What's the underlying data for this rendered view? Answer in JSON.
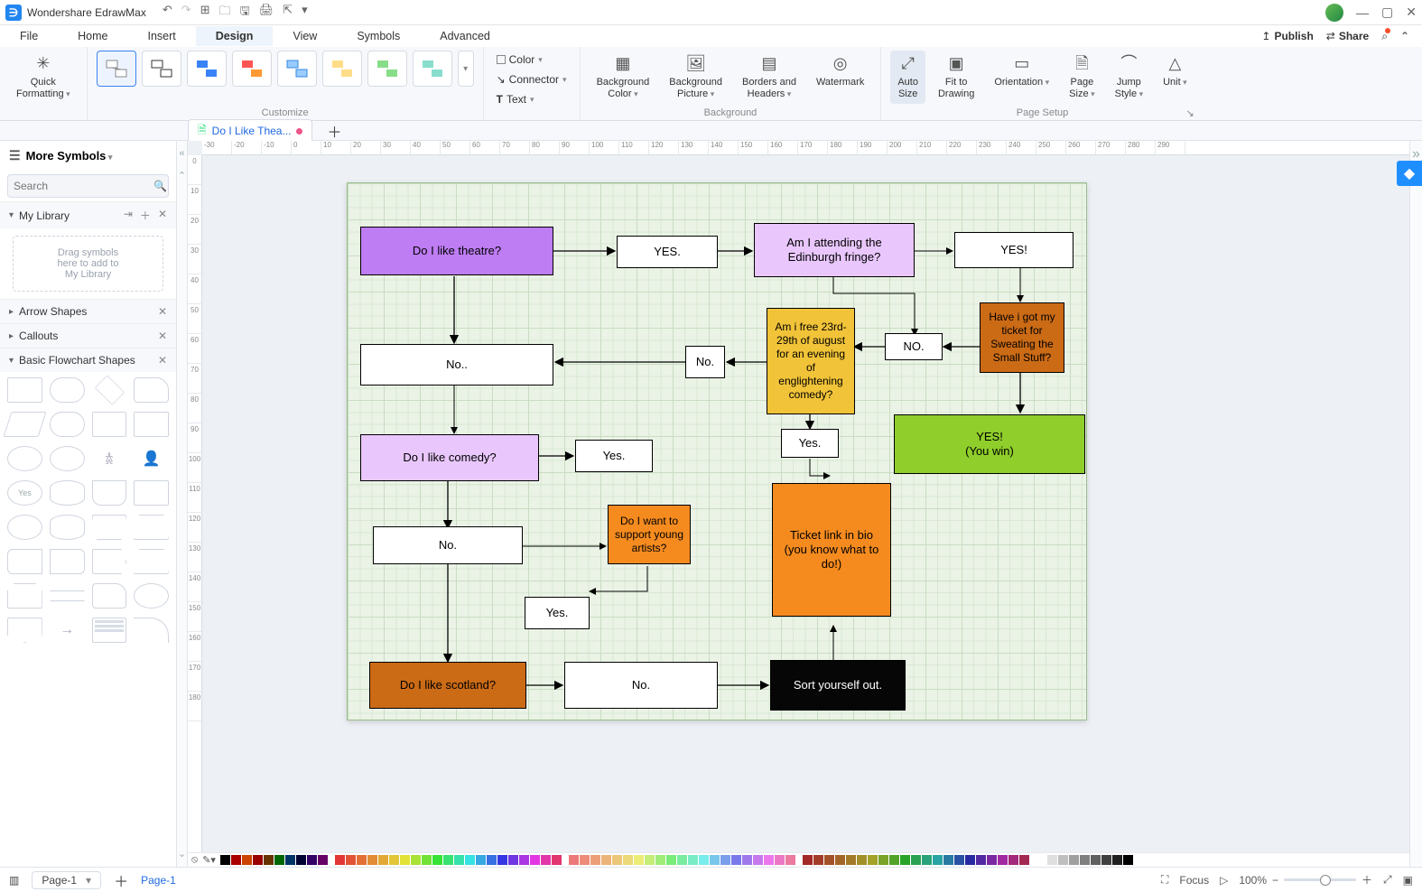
{
  "app_title": "Wondershare EdrawMax",
  "menus": [
    "File",
    "Home",
    "Insert",
    "Design",
    "View",
    "Symbols",
    "Advanced"
  ],
  "active_menu": "Design",
  "topbar_actions": {
    "publish": "Publish",
    "share": "Share"
  },
  "ribbon": {
    "quick_fmt": "Quick\nFormatting",
    "customize_label": "Customize",
    "color": "Color",
    "connector": "Connector",
    "text": "Text",
    "bg_color": "Background\nColor",
    "bg_pic": "Background\nPicture",
    "borders": "Borders and\nHeaders",
    "watermark": "Watermark",
    "background_label": "Background",
    "auto_size": "Auto\nSize",
    "fit": "Fit to\nDrawing",
    "orientation": "Orientation",
    "page_size": "Page\nSize",
    "jump": "Jump\nStyle",
    "unit": "Unit",
    "page_setup_label": "Page Setup"
  },
  "doc_tab": "Do I Like Thea...",
  "left": {
    "more_symbols": "More Symbols",
    "search_placeholder": "Search",
    "my_library": "My Library",
    "dropzone": "Drag symbols\nhere to add to\nMy Library",
    "arrow_shapes": "Arrow Shapes",
    "callouts": "Callouts",
    "basic_flow": "Basic Flowchart Shapes"
  },
  "ruler_h": [
    "-30",
    "-20",
    "-10",
    "0",
    "10",
    "20",
    "30",
    "40",
    "50",
    "60",
    "70",
    "80",
    "90",
    "100",
    "110",
    "120",
    "130",
    "140",
    "150",
    "160",
    "170",
    "180",
    "190",
    "200",
    "210",
    "220",
    "230",
    "240",
    "250",
    "260",
    "270",
    "280",
    "290"
  ],
  "ruler_v": [
    "0",
    "10",
    "20",
    "30",
    "40",
    "50",
    "60",
    "70",
    "80",
    "90",
    "100",
    "110",
    "120",
    "130",
    "140",
    "150",
    "160",
    "170",
    "180"
  ],
  "nodes": {
    "n1": "Do I like theatre?",
    "n2": "YES.",
    "n3": "Am I attending the Edinburgh fringe?",
    "n4": "YES!",
    "n5": "Have i got my ticket for Sweating the Small Stuff?",
    "n6": "NO.",
    "n7": "Am i free 23rd-29th of august for an evening of englightening comedy?",
    "n8": "No.",
    "n9": "No..",
    "n10": "Do I like comedy?",
    "n11": "Yes.",
    "n12": "Yes.",
    "n13": "YES!\n(You win)",
    "n14": "Ticket link in bio (you know what to do!)",
    "n15": "No.",
    "n16": "Do I want to support young artists?",
    "n17": "Yes.",
    "n18": "Do I like scotland?",
    "n19": "No.",
    "n20": "Sort yourself out."
  },
  "page_label": "Page-1",
  "page_link": "Page-1",
  "status": {
    "focus": "Focus",
    "zoom": "100%"
  },
  "chart_data": {
    "type": "flowchart",
    "nodes": [
      {
        "id": "n1",
        "text": "Do I like theatre?",
        "color": "purple"
      },
      {
        "id": "n2",
        "text": "YES.",
        "color": "white"
      },
      {
        "id": "n3",
        "text": "Am I attending the Edinburgh fringe?",
        "color": "light-purple"
      },
      {
        "id": "n4",
        "text": "YES!",
        "color": "white"
      },
      {
        "id": "n5",
        "text": "Have i got my ticket for Sweating the Small Stuff?",
        "color": "dark-orange"
      },
      {
        "id": "n6",
        "text": "NO.",
        "color": "white"
      },
      {
        "id": "n7",
        "text": "Am i free 23rd-29th of august for an evening of englightening comedy?",
        "color": "yellow"
      },
      {
        "id": "n8",
        "text": "No.",
        "color": "white"
      },
      {
        "id": "n9",
        "text": "No..",
        "color": "white"
      },
      {
        "id": "n10",
        "text": "Do I like comedy?",
        "color": "light-purple"
      },
      {
        "id": "n11",
        "text": "Yes.",
        "color": "white"
      },
      {
        "id": "n12",
        "text": "Yes.",
        "color": "white"
      },
      {
        "id": "n13",
        "text": "YES!\n(You win)",
        "color": "green"
      },
      {
        "id": "n14",
        "text": "Ticket link in bio (you know what to do!)",
        "color": "orange"
      },
      {
        "id": "n15",
        "text": "No.",
        "color": "white"
      },
      {
        "id": "n16",
        "text": "Do I want to support young artists?",
        "color": "orange"
      },
      {
        "id": "n17",
        "text": "Yes.",
        "color": "white"
      },
      {
        "id": "n18",
        "text": "Do I like scotland?",
        "color": "dark-orange"
      },
      {
        "id": "n19",
        "text": "No.",
        "color": "white"
      },
      {
        "id": "n20",
        "text": "Sort yourself out.",
        "color": "black"
      }
    ],
    "edges": [
      [
        "n1",
        "n2"
      ],
      [
        "n2",
        "n3"
      ],
      [
        "n3",
        "n4"
      ],
      [
        "n4",
        "n5"
      ],
      [
        "n5",
        "n6"
      ],
      [
        "n6",
        "n7"
      ],
      [
        "n7",
        "n8"
      ],
      [
        "n8",
        "n9"
      ],
      [
        "n5",
        "n13"
      ],
      [
        "n7",
        "n12"
      ],
      [
        "n12",
        "n14"
      ],
      [
        "n1",
        "n9"
      ],
      [
        "n9",
        "n10"
      ],
      [
        "n10",
        "n11"
      ],
      [
        "n11",
        "n3"
      ],
      [
        "n10",
        "n15"
      ],
      [
        "n15",
        "n16"
      ],
      [
        "n16",
        "n17"
      ],
      [
        "n17",
        "n14"
      ],
      [
        "n15",
        "n18"
      ],
      [
        "n18",
        "n19"
      ],
      [
        "n19",
        "n20"
      ],
      [
        "n20",
        "n14"
      ],
      [
        "n3",
        "n6"
      ]
    ]
  },
  "palette": [
    "#000000",
    "#c00000",
    "#e06000",
    "#f0a000",
    "#f0d000",
    "#90c030",
    "#40a060",
    "#3090c0",
    "#3060c0",
    "#6040c0",
    "#a040c0",
    "#c04080",
    "#808080",
    "#c0c0c0",
    "#ffffff"
  ]
}
